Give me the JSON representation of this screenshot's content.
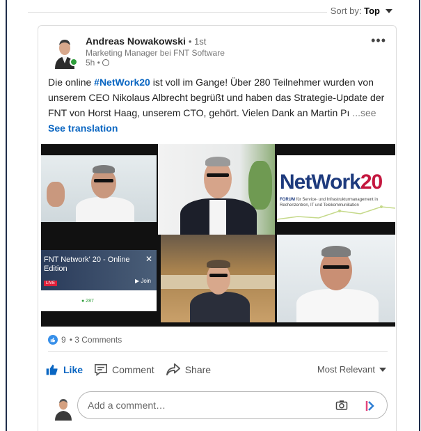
{
  "feed": {
    "sort_prefix": "Sort by:",
    "sort_value": "Top"
  },
  "post": {
    "author": {
      "name": "Andreas Nowakowski",
      "degree": "• 1st",
      "headline": "Marketing Manager bei FNT Software",
      "time": "5h •"
    },
    "text": {
      "before": "Die online ",
      "hashtag": "#NetWork20",
      "after": " ist voll im Gange! Über 280 Teilnehmer wurden von unserem CEO Nikolaus Albrecht begrüßt und haben das Strategie-Update der FNT von Horst Haag, unserem CTO, gehört. Vielen Dank an Martin Pı",
      "see_more": "...see more"
    },
    "see_translation": "See translation",
    "media": {
      "slide_title_main": "NetWork",
      "slide_title_num": "20",
      "slide_subtitle_bold": "FORUM",
      "slide_subtitle": "für Service- und Infrastrukturmanagement in Rechenzentren, IT und Telekommunikation",
      "overlay_title": "FNT Network' 20 - Online Edition",
      "overlay_close": "✕",
      "overlay_live": "LIVE",
      "overlay_join": "▶ Join",
      "overlay_count": "● 287"
    },
    "social": {
      "reactions": "9",
      "comments": "• 3 Comments"
    },
    "actions": {
      "like": "Like",
      "comment": "Comment",
      "share": "Share"
    },
    "comments_sort": "Most Relevant",
    "comment_placeholder": "Add a comment…"
  },
  "colors": {
    "accent": "#0a66c2",
    "online": "#2e9d3a",
    "like_bubble": "#378fe9",
    "frame": "#1f2d4a"
  },
  "icons": [
    "more-icon",
    "globe-icon",
    "like-reaction-icon",
    "thumbs-up-icon",
    "comment-icon",
    "share-icon",
    "chevron-down-icon",
    "camera-icon",
    "gif-icon"
  ]
}
